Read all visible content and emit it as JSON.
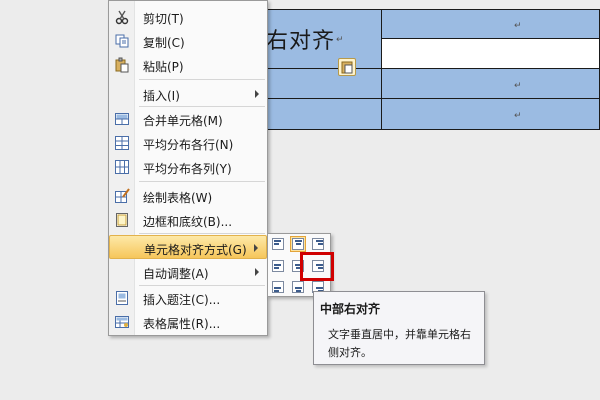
{
  "document": {
    "cell_text": "右对齐",
    "paragraph_mark": "↵"
  },
  "context_menu": {
    "items": [
      {
        "label": "剪切(T)",
        "icon": "scissors-icon"
      },
      {
        "label": "复制(C)",
        "icon": "copy-icon"
      },
      {
        "label": "粘贴(P)",
        "icon": "paste-icon"
      },
      {
        "label": "插入(I)",
        "icon": "",
        "submenu": true
      },
      {
        "label": "合并单元格(M)",
        "icon": "merge-cells-icon"
      },
      {
        "label": "平均分布各行(N)",
        "icon": "distribute-rows-icon"
      },
      {
        "label": "平均分布各列(Y)",
        "icon": "distribute-columns-icon"
      },
      {
        "label": "绘制表格(W)",
        "icon": "draw-table-icon"
      },
      {
        "label": "边框和底纹(B)...",
        "icon": "borders-icon"
      },
      {
        "label": "单元格对齐方式(G)",
        "icon": "",
        "submenu": true,
        "highlighted": true
      },
      {
        "label": "自动调整(A)",
        "icon": "",
        "submenu": true
      },
      {
        "label": "插入题注(C)...",
        "icon": "caption-icon"
      },
      {
        "label": "表格属性(R)...",
        "icon": "table-properties-icon"
      }
    ]
  },
  "alignment_submenu": {
    "options": [
      "align-top-left",
      "align-top-center",
      "align-top-right",
      "align-middle-left",
      "align-middle-center",
      "align-middle-right",
      "align-bottom-left",
      "align-bottom-center",
      "align-bottom-right"
    ],
    "hovered": "align-middle-right",
    "active": "align-top-center"
  },
  "tooltip": {
    "title": "中部右对齐",
    "body": "文字垂直居中，并靠单元格右侧对齐。"
  },
  "colors": {
    "table_cell_fill": "#9bbbe2",
    "menu_highlight": "#f6c65b",
    "callout_box": "#d00000"
  }
}
